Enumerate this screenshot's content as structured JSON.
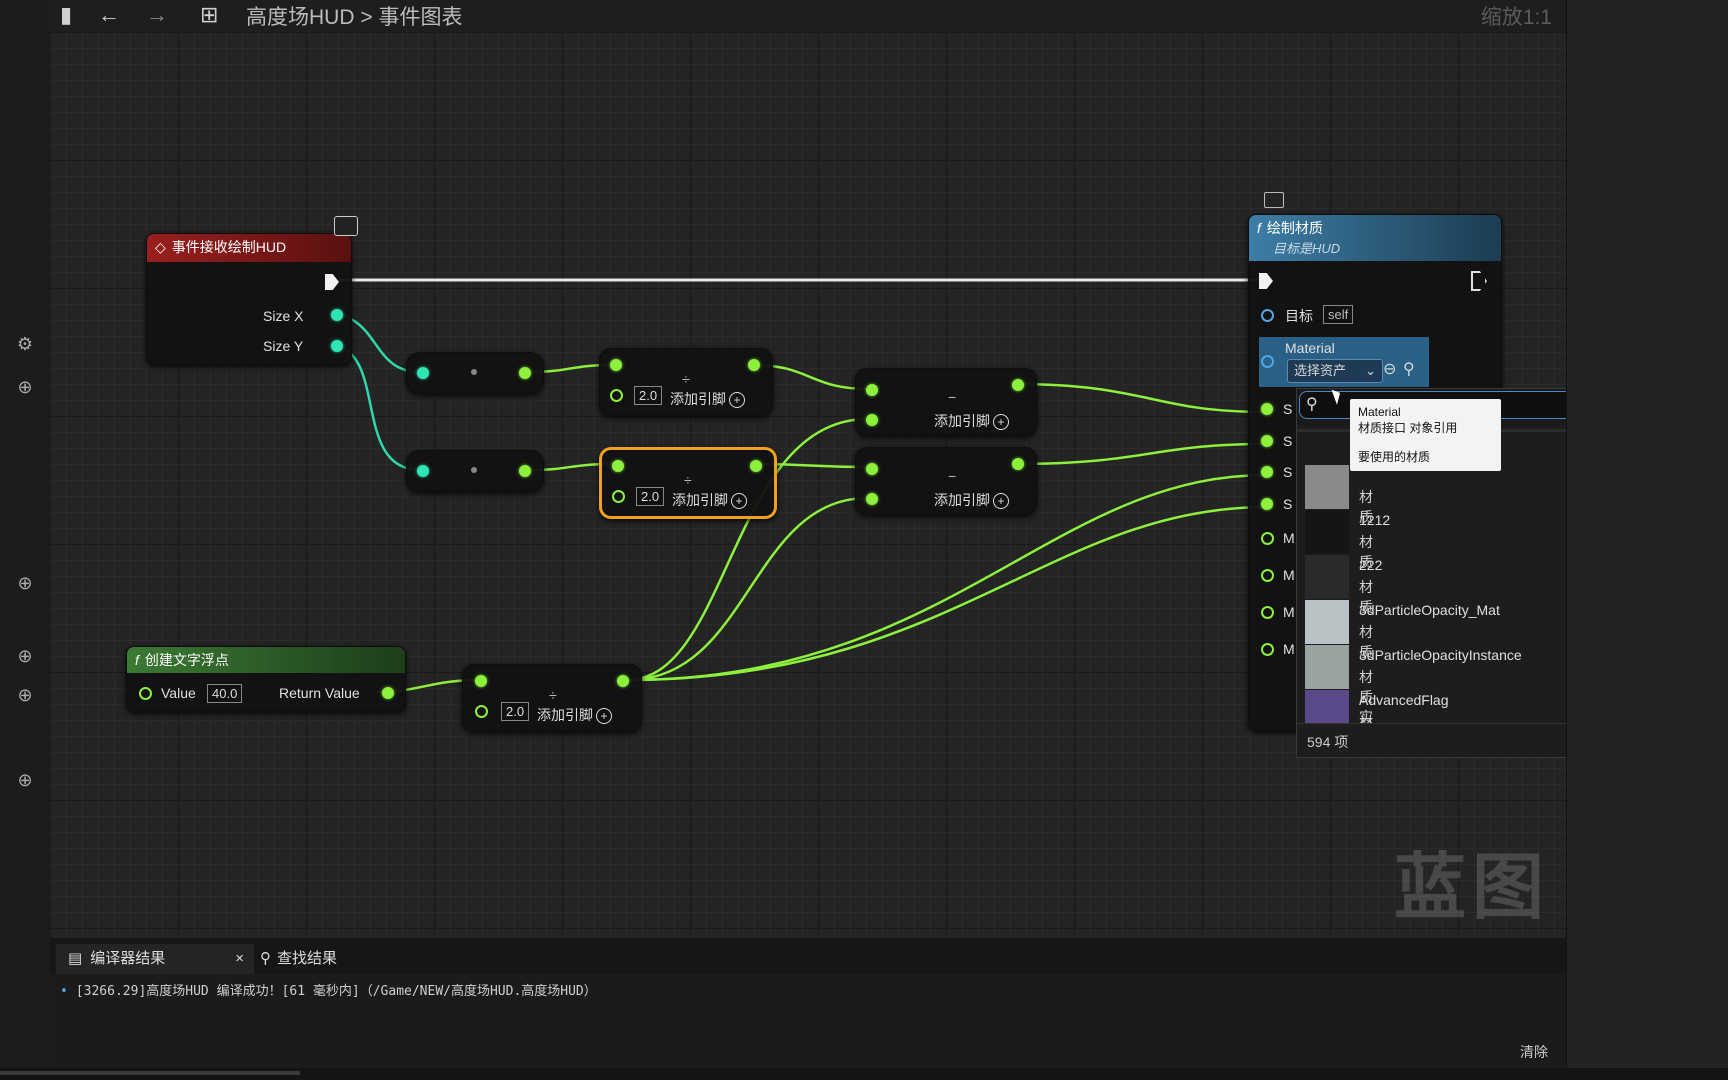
{
  "toolbar": {
    "breadcrumb_root": "高度场HUD",
    "breadcrumb_sep": ">",
    "breadcrumb_leaf": "事件图表",
    "zoom": "缩放1:1"
  },
  "nodes": {
    "event": {
      "title": "事件接收绘制HUD",
      "pin_size_x": "Size X",
      "pin_size_y": "Size Y"
    },
    "div1": {
      "op": "÷",
      "value": "2.0",
      "add_pin": "添加引脚"
    },
    "div2": {
      "op": "÷",
      "value": "2.0",
      "add_pin": "添加引脚"
    },
    "div3": {
      "op": "÷",
      "value": "2.0",
      "add_pin": "添加引脚"
    },
    "sub1": {
      "op": "−",
      "add_pin": "添加引脚"
    },
    "sub2": {
      "op": "−",
      "add_pin": "添加引脚"
    },
    "create_float": {
      "title": "创建文字浮点",
      "value_label": "Value",
      "value": "40.0",
      "return_label": "Return Value"
    },
    "draw_material": {
      "title": "绘制材质",
      "subtitle": "目标是HUD",
      "target_label": "目标",
      "target_value": "self",
      "material_label": "Material",
      "select_asset": "选择资产",
      "pin_s": "S",
      "pin_m": "M"
    }
  },
  "picker": {
    "search_placeholder": "",
    "items": [
      {
        "name": "",
        "type": "材质",
        "thumb_color": "#8a8a8a"
      },
      {
        "name": "1212",
        "type": "材质",
        "thumb_color": "#151515"
      },
      {
        "name": "222",
        "type": "材质",
        "thumb_color": "#2a2a2a"
      },
      {
        "name": "3dParticleOpacity_Mat",
        "type": "材质",
        "thumb_color": "#b9c2c4"
      },
      {
        "name": "3dParticleOpacityInstance",
        "type": "材质实例",
        "thumb_color": "#9aa39f"
      },
      {
        "name": "AdvancedFlag",
        "type": "材质",
        "thumb_color": "#5a4a8a"
      }
    ],
    "count": "594 项"
  },
  "tooltip": {
    "line1": "Material",
    "line2": "材质接口 对象引用",
    "line3": "要使用的材质"
  },
  "bottom": {
    "tab_compiler": "编译器结果",
    "tab_close": "×",
    "tab_find": "查找结果",
    "log_line": "[3266.29]高度场HUD 编译成功！[61 毫秒内]（/Game/NEW/高度场HUD.高度场HUD）",
    "clear": "清除"
  },
  "watermark": "蓝图",
  "colors": {
    "float_pin": "#8cf03c",
    "int_pin": "#2ee5b4",
    "event_head": "#8a1b1b",
    "func_head": "#2b5a78",
    "pure_head": "#2f5a2a",
    "selected": "#f0a020"
  }
}
